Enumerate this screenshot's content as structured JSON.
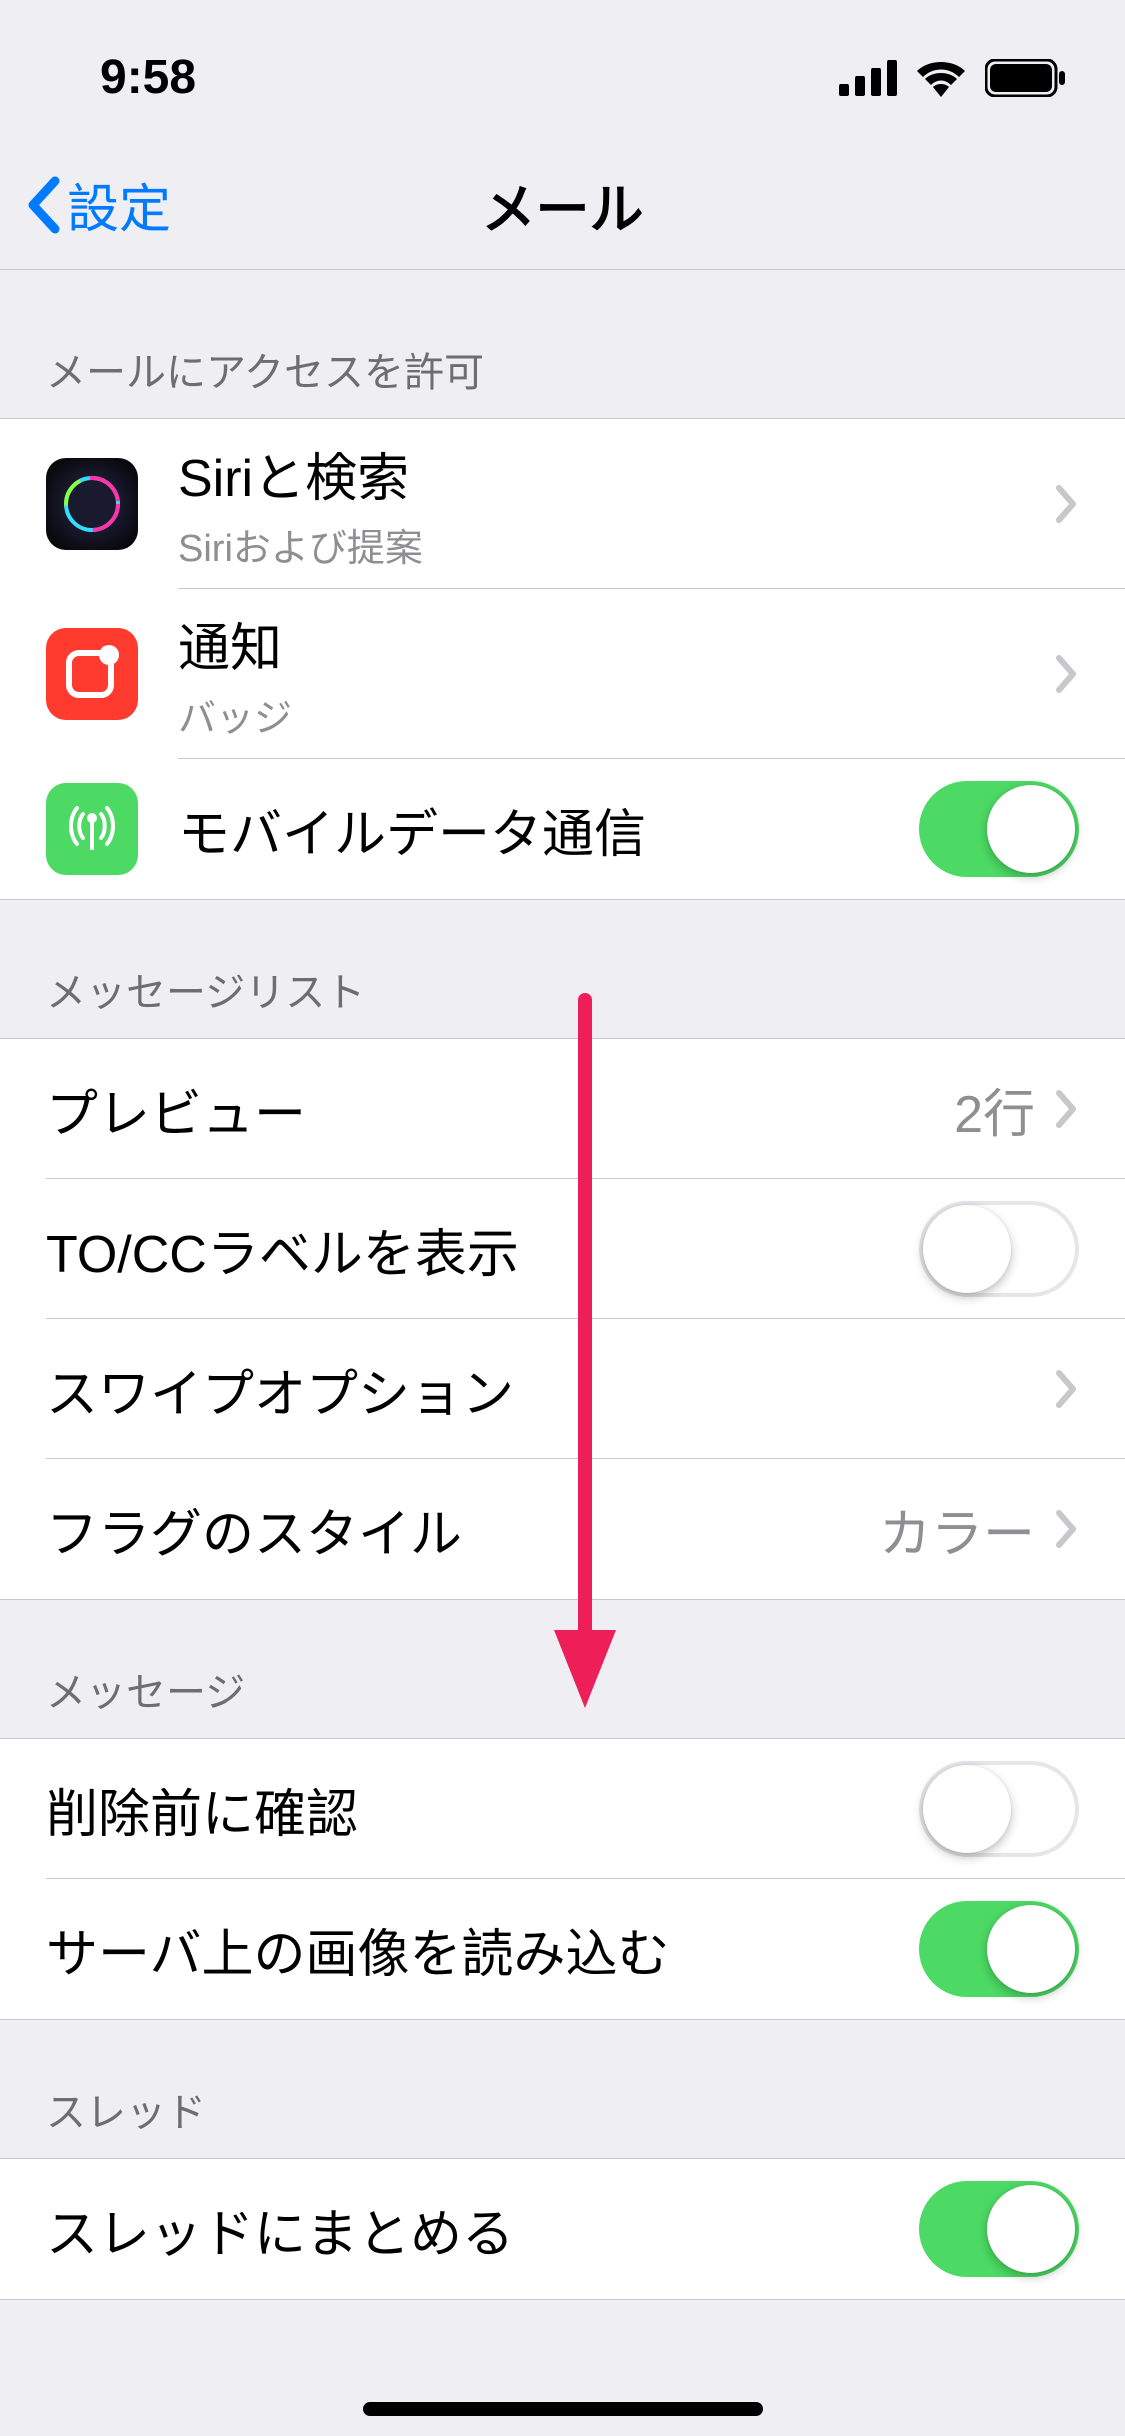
{
  "status": {
    "time": "9:58"
  },
  "nav": {
    "back": "設定",
    "title": "メール"
  },
  "sections": {
    "access": {
      "header": "メールにアクセスを許可",
      "siri": {
        "title": "Siriと検索",
        "subtitle": "Siriおよび提案"
      },
      "notifications": {
        "title": "通知",
        "subtitle": "バッジ"
      },
      "cellular": {
        "title": "モバイルデータ通信",
        "on": true
      }
    },
    "messageList": {
      "header": "メッセージリスト",
      "preview": {
        "title": "プレビュー",
        "value": "2行"
      },
      "tocc": {
        "title": "TO/CCラベルを表示",
        "on": false
      },
      "swipe": {
        "title": "スワイプオプション"
      },
      "flag": {
        "title": "フラグのスタイル",
        "value": "カラー"
      }
    },
    "message": {
      "header": "メッセージ",
      "confirmDelete": {
        "title": "削除前に確認",
        "on": false
      },
      "loadImages": {
        "title": "サーバ上の画像を読み込む",
        "on": true
      }
    },
    "thread": {
      "header": "スレッド",
      "organize": {
        "title": "スレッドにまとめる",
        "on": true
      }
    }
  }
}
